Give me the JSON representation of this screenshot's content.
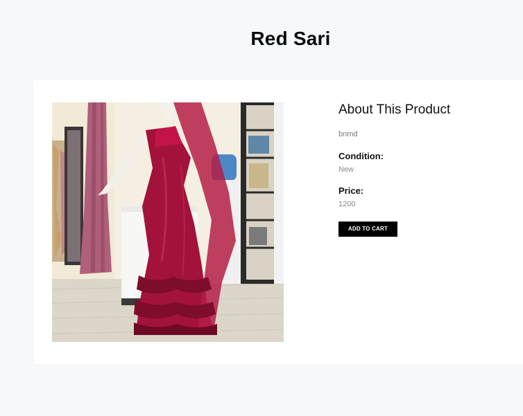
{
  "page": {
    "title": "Red Sari"
  },
  "product": {
    "image_subject": "red ruffled sari on mannequin",
    "section_heading": "About This Product",
    "description": "bnmd",
    "condition_label": "Condition:",
    "condition_value": "New",
    "price_label": "Price:",
    "price_value": "1200",
    "add_to_cart_label": "ADD TO CART"
  },
  "colors": {
    "page_background": "#f6f8fa",
    "card_background": "#ffffff",
    "button_background": "#000000",
    "sari_red": "#a3123a"
  }
}
